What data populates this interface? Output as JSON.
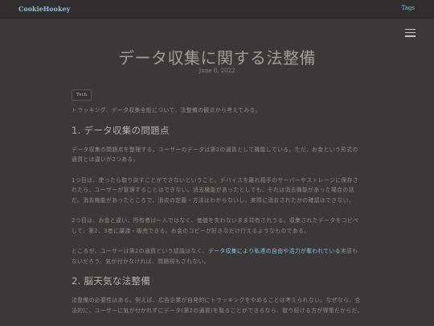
{
  "header": {
    "brand": "CookieHookey",
    "tags_label": "Tags"
  },
  "icons": {
    "menu": "hamburger-menu-icon"
  },
  "post": {
    "title": "データ収集に関する法整備",
    "date": "June 8, 2022",
    "tag": "Tech",
    "intro": "トラッキング、データ収集全般について、法整備の観点から考えてみる。",
    "section1_heading": "1. データ収集の問題点",
    "s1_p1": "データ収集の問題点を整理する。ユーザーのデータは第2の通貨として機能している。ただ、お金という形式の通貨とは違いが2つある。",
    "s1_p2": "1つ目は、使ったら取り戻すことができないということ。デバイスを離れ相手のサーバーやストレージに保存されたら、ユーザーが管理することはできない。消去機能があったとしても、それは消去機能があった場合の話だ。消去機能があったところで、消去の定義・方法はわからないし、実際に消去されたかの確認はできない。",
    "s1_p3": "2つ目は、お金と違い、所有者は一人ではなく、価値を失わないまま共有されうる。収集されたデータをコピペして、第2、3者に譲渡・販売できる。お金のコピーが好きなだけ行えるようなものである。",
    "s1_p4_before": "ところが、ユーザーは第2の通貨という認識はなく、",
    "s1_p4_link": "データ収集により私達の自由や活力が奪われている",
    "s1_p4_after": "実感もないだろう。気が付かなければ、問題視もされない。",
    "section2_heading": "2. 脳天気な法整備",
    "s2_p1": "法整備の必要性はある。例えば、広告企業が自発的にトラッキングをやめることは考えられない。なぜなら、合法的に、ユーザーに気が付かれずにデータ(第2の通貨)を取ることができるなら、取り続ける方が得策だからだ。"
  }
}
